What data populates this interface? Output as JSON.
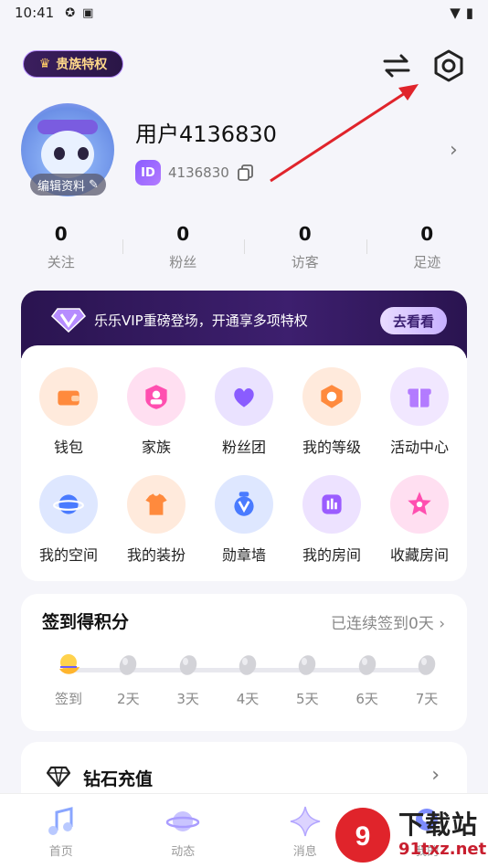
{
  "status_bar": {
    "time": "10:41"
  },
  "header": {
    "vip_badge": "贵族特权"
  },
  "profile": {
    "username": "用户4136830",
    "id_label": "ID",
    "id_value": "4136830",
    "edit_label": "编辑资料"
  },
  "stats": [
    {
      "value": "0",
      "label": "关注"
    },
    {
      "value": "0",
      "label": "粉丝"
    },
    {
      "value": "0",
      "label": "访客"
    },
    {
      "value": "0",
      "label": "足迹"
    }
  ],
  "vip_banner": {
    "text": "乐乐VIP重磅登场，开通享多项特权",
    "button": "去看看"
  },
  "grid": {
    "row1": [
      {
        "label": "钱包",
        "icon": "wallet-icon",
        "color": "#ff8a3d"
      },
      {
        "label": "家族",
        "icon": "family-icon",
        "color": "#ff4fb0"
      },
      {
        "label": "粉丝团",
        "icon": "fan-club-icon",
        "color": "#8a5cff"
      },
      {
        "label": "我的等级",
        "icon": "level-icon",
        "color": "#ff8a3d"
      },
      {
        "label": "活动中心",
        "icon": "gift-icon",
        "color": "#b37bff"
      }
    ],
    "row2": [
      {
        "label": "我的空间",
        "icon": "planet-icon",
        "color": "#4a7bff"
      },
      {
        "label": "我的装扮",
        "icon": "outfit-icon",
        "color": "#ff8a3d"
      },
      {
        "label": "勋章墙",
        "icon": "medal-icon",
        "color": "#4a7bff"
      },
      {
        "label": "我的房间",
        "icon": "room-icon",
        "color": "#9b5cff"
      },
      {
        "label": "收藏房间",
        "icon": "star-icon",
        "color": "#ff4fb0"
      }
    ]
  },
  "signin": {
    "title": "签到得积分",
    "status": "已连续签到0天",
    "days": [
      "签到",
      "2天",
      "3天",
      "4天",
      "5天",
      "6天",
      "7天"
    ]
  },
  "diamond": {
    "title": "钻石充值"
  },
  "tabs": [
    {
      "label": "首页",
      "icon": "music-note-icon"
    },
    {
      "label": "动态",
      "icon": "planet-tab-icon"
    },
    {
      "label": "消息",
      "icon": "sparkle-icon"
    },
    {
      "label": "我的",
      "icon": "profile-tab-icon"
    }
  ],
  "watermark": {
    "logo_text": "下载站",
    "url": "91txz.net"
  },
  "colors": {
    "accent": "#8a5cff",
    "banner_bg": "#2a1450",
    "annotation_arrow": "#e0242b"
  }
}
